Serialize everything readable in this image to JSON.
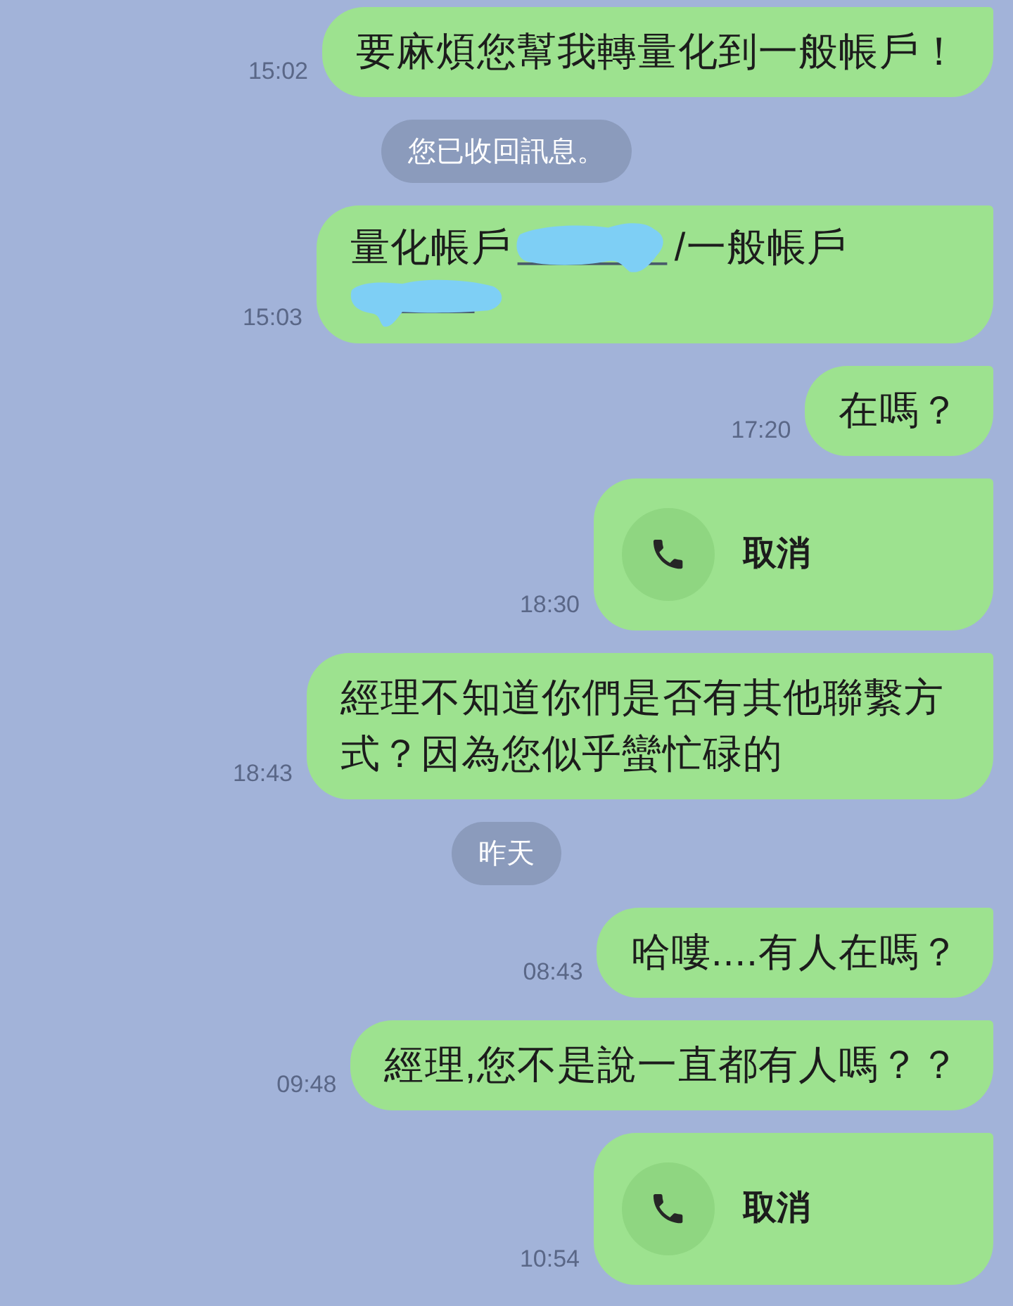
{
  "chat": {
    "items": [
      {
        "kind": "message",
        "time": "15:02",
        "text": "要麻煩您幫我轉量化到一般帳戶！"
      },
      {
        "kind": "notice",
        "text": "您已收回訊息。"
      },
      {
        "kind": "redacted_message",
        "time": "15:03",
        "lines": [
          [
            {
              "kind": "text",
              "text": "量化帳戶"
            },
            {
              "kind": "redaction"
            },
            {
              "kind": "text",
              "text": "/一般帳戶"
            }
          ],
          [
            {
              "kind": "redaction"
            }
          ]
        ]
      },
      {
        "kind": "message",
        "time": "17:20",
        "text": "在嗎？"
      },
      {
        "kind": "call",
        "time": "18:30",
        "label": "取消"
      },
      {
        "kind": "message",
        "time": "18:43",
        "text": "經理不知道你們是否有其他聯繫方式？因為您似乎蠻忙碌的"
      },
      {
        "kind": "date",
        "text": "昨天"
      },
      {
        "kind": "message",
        "time": "08:43",
        "text": "哈嘍....有人在嗎？"
      },
      {
        "kind": "message",
        "time": "09:48",
        "text": "經理,您不是說一直都有人嗎？？"
      },
      {
        "kind": "call",
        "time": "10:54",
        "label": "取消"
      }
    ]
  }
}
